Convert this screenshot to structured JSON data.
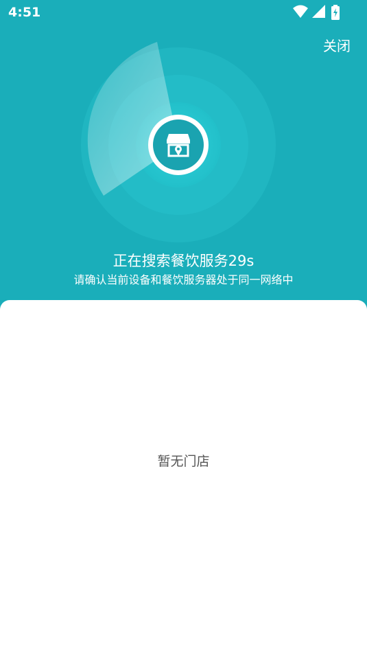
{
  "status_bar": {
    "time": "4:51",
    "icons": [
      "wifi-icon",
      "cellular-signal-icon",
      "battery-charging-icon"
    ]
  },
  "header": {
    "close_label": "关闭"
  },
  "search": {
    "title": "正在搜索餐饮服务29s",
    "subtitle": "请确认当前设备和餐饮服务器处于同一网络中",
    "center_icon": "store-location-icon"
  },
  "results": {
    "empty_text": "暂无门店"
  },
  "colors": {
    "background": "#1aaeba",
    "radar_inner": "#26c6d0",
    "sheet": "#ffffff"
  }
}
